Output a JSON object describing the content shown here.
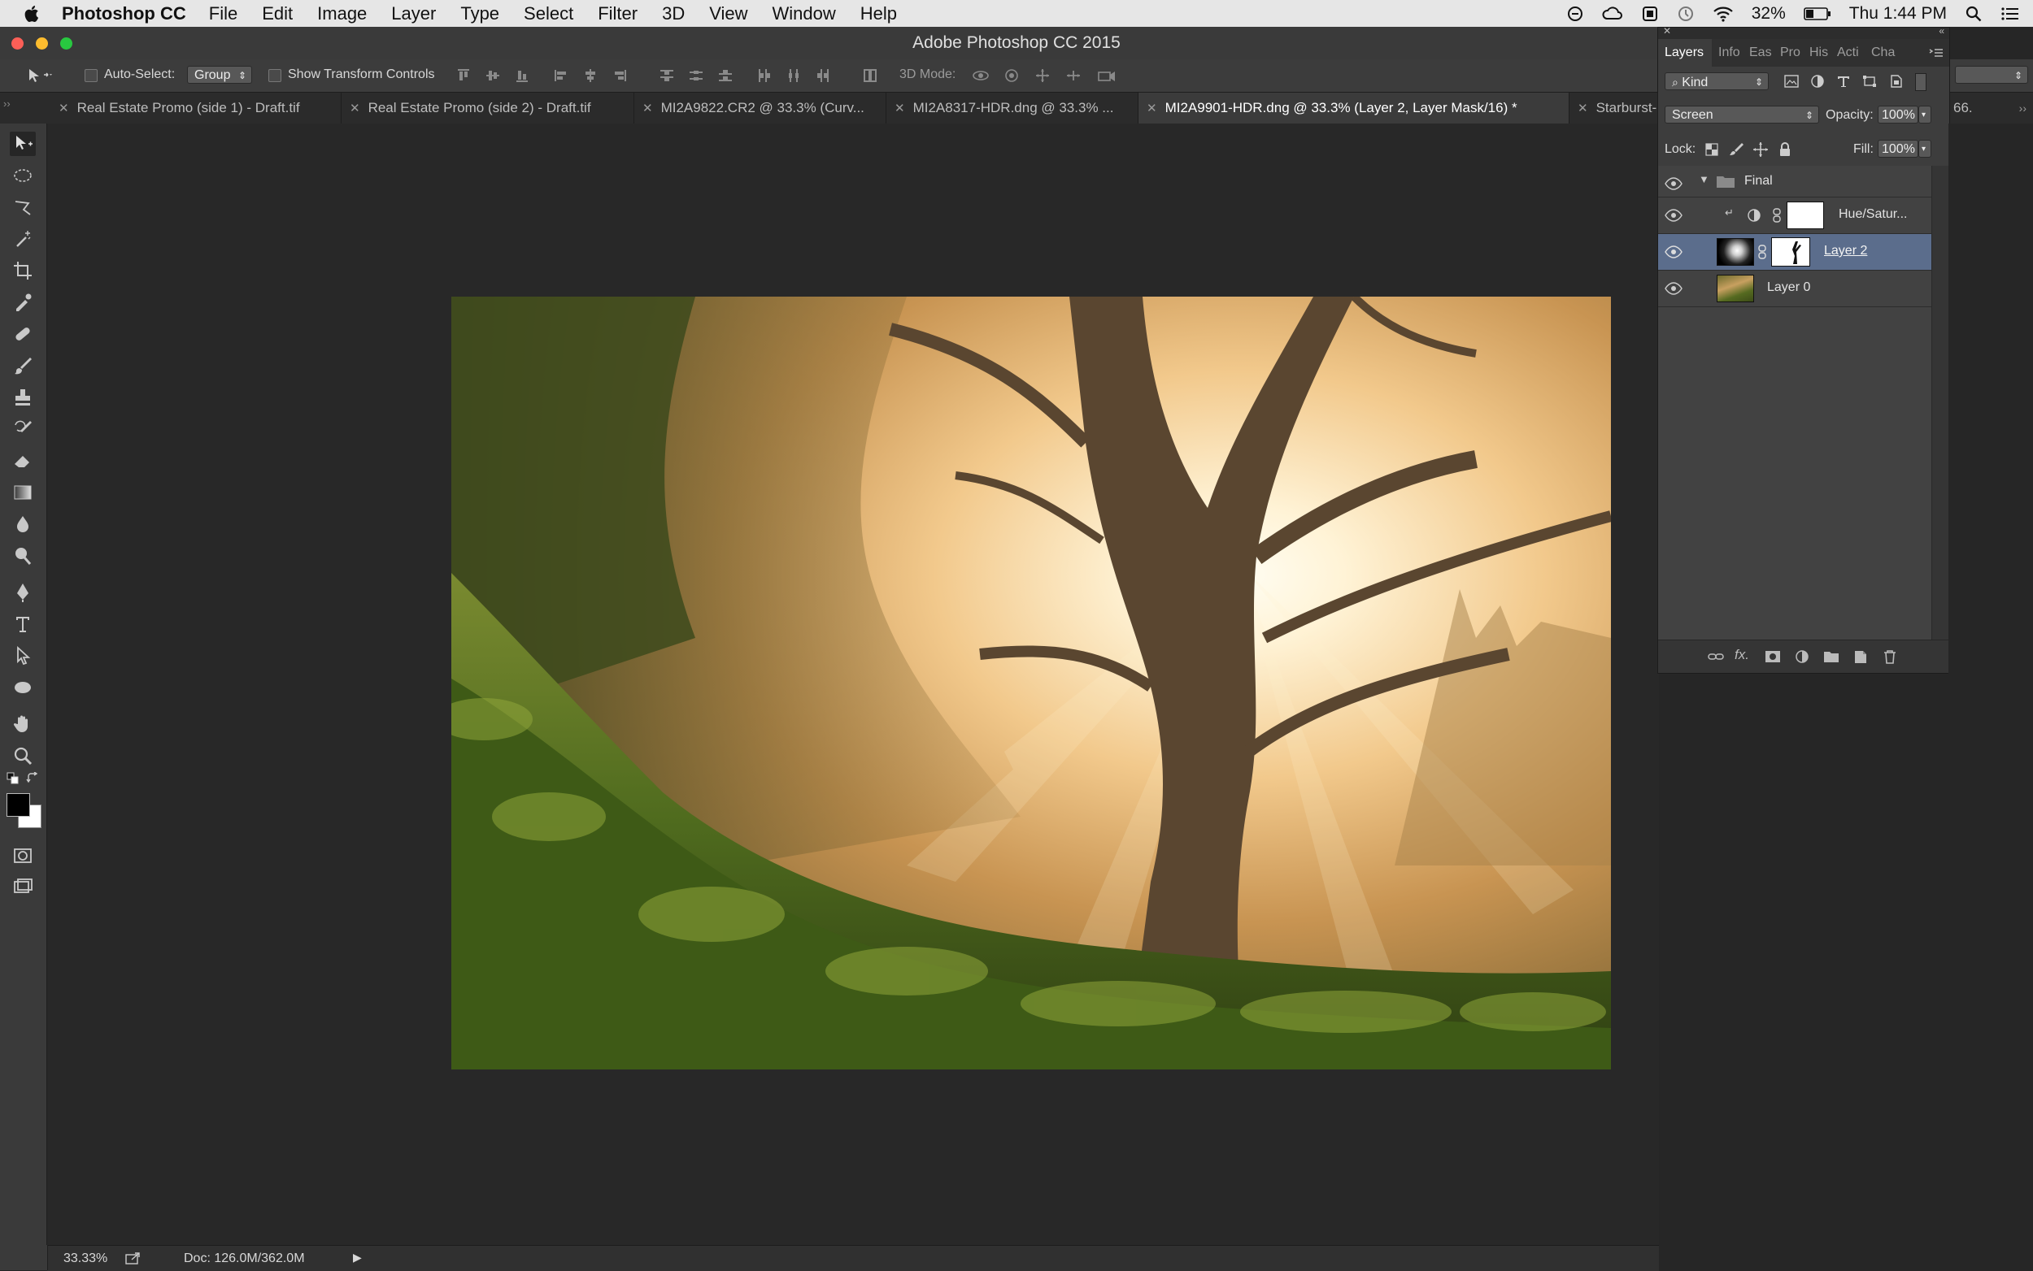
{
  "menubar": {
    "app": "Photoshop CC",
    "items": [
      "File",
      "Edit",
      "Image",
      "Layer",
      "Type",
      "Select",
      "Filter",
      "3D",
      "View",
      "Window",
      "Help"
    ],
    "battery": "32%",
    "clock": "Thu 1:44 PM"
  },
  "window": {
    "title": "Adobe Photoshop CC 2015"
  },
  "options_bar": {
    "auto_select_label": "Auto-Select:",
    "auto_select_value": "Group",
    "show_transform_label": "Show Transform Controls",
    "mode_label": "3D Mode:"
  },
  "tabs": [
    "Real Estate Promo (side 1) - Draft.tif",
    "Real Estate Promo (side 2) - Draft.tif",
    "MI2A9822.CR2 @ 33.3% (Curv...",
    "MI2A8317-HDR.dng @ 33.3% ...",
    "MI2A9901-HDR.dng @ 33.3% (Layer 2, Layer Mask/16) *",
    "Starburst-"
  ],
  "tabs_overflow": "66.",
  "status": {
    "zoom": "33.33%",
    "doc": "Doc: 126.0M/362.0M"
  },
  "layers_panel": {
    "tabs": [
      "Layers",
      "Info",
      "Eas",
      "Pro",
      "His",
      "Acti",
      "Cha"
    ],
    "filter_kind": "Kind",
    "blend_mode": "Screen",
    "opacity_label": "Opacity:",
    "opacity_value": "100%",
    "lock_label": "Lock:",
    "fill_label": "Fill:",
    "fill_value": "100%",
    "layers": [
      {
        "name": "Final"
      },
      {
        "name": "Hue/Satur..."
      },
      {
        "name": "Layer 2"
      },
      {
        "name": "Layer 0"
      }
    ]
  },
  "colors": {
    "accent": "#5b6d8c",
    "foreground": "#000000",
    "background": "#ffffff"
  }
}
